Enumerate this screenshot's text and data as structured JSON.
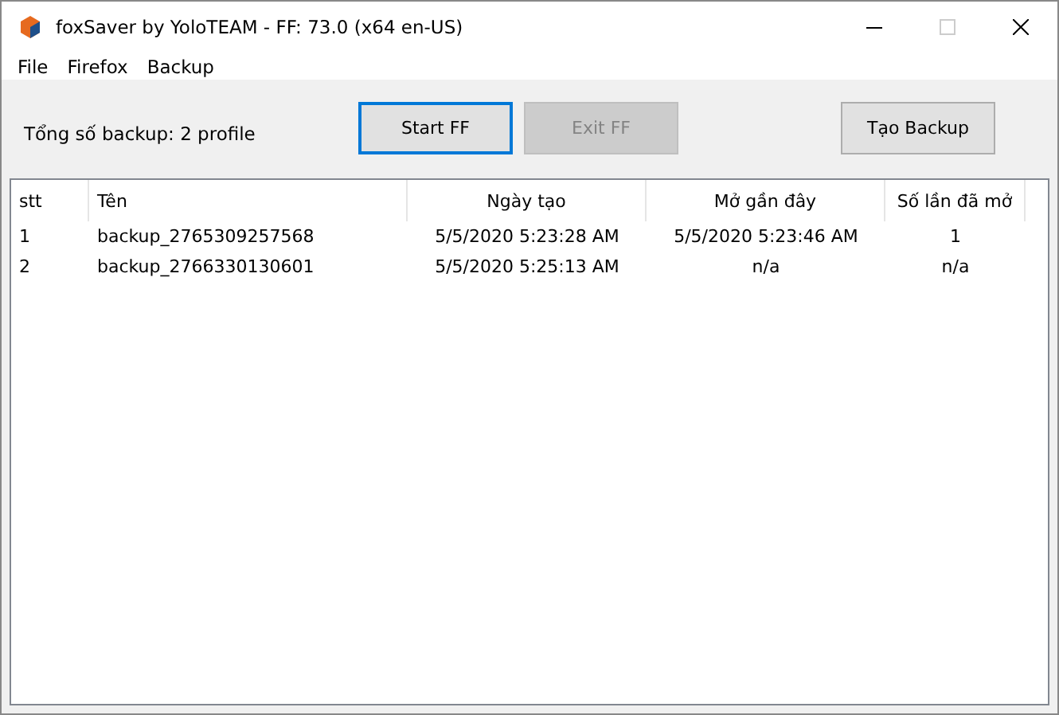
{
  "window": {
    "title": "foxSaver by YoloTEAM - FF: 73.0 (x64 en-US)"
  },
  "menu": [
    "File",
    "Firefox",
    "Backup"
  ],
  "summary": "Tổng số backup: 2 profile",
  "buttons": [
    {
      "label": "Start FF",
      "focused": true,
      "disabled": false
    },
    {
      "label": "Exit FF",
      "focused": false,
      "disabled": true
    },
    {
      "label": "Tạo Backup",
      "focused": false,
      "disabled": false
    }
  ],
  "table": {
    "columns": [
      "stt",
      "Tên",
      "Ngày tạo",
      "Mở gần đây",
      "Số lần đã mở"
    ],
    "rows": [
      [
        "1",
        "backup_2765309257568",
        "5/5/2020 5:23:28 AM",
        "5/5/2020 5:23:46 AM",
        "1"
      ],
      [
        "2",
        "backup_2766330130601",
        "5/5/2020 5:25:13 AM",
        "n/a",
        "n/a"
      ]
    ]
  }
}
